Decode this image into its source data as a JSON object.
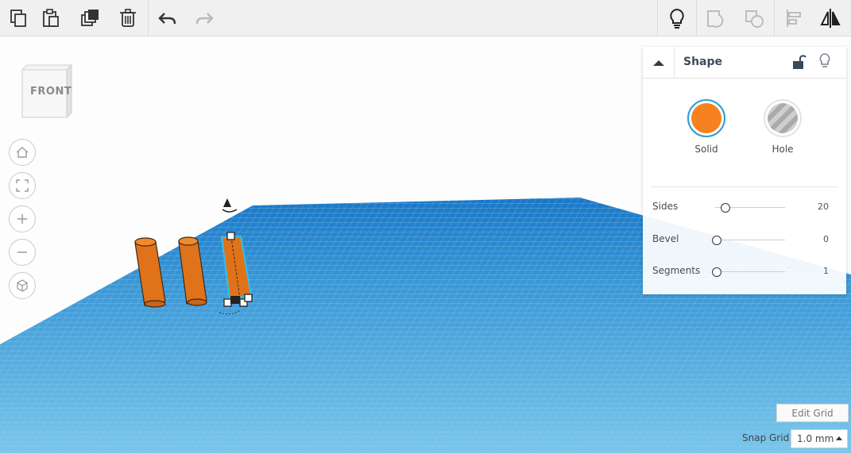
{
  "toolbar": {
    "left_tools": [
      {
        "name": "copy-icon"
      },
      {
        "name": "paste-icon"
      },
      {
        "name": "duplicate-icon"
      },
      {
        "name": "delete-icon"
      },
      {
        "name": "undo-icon"
      },
      {
        "name": "redo-icon"
      }
    ],
    "right_tools": [
      {
        "name": "lightbulb-icon"
      },
      {
        "name": "group-icon"
      },
      {
        "name": "ungroup-icon"
      },
      {
        "name": "align-icon"
      },
      {
        "name": "mirror-icon"
      }
    ]
  },
  "viewcube": {
    "face_label": "FRONT"
  },
  "nav": [
    {
      "name": "home-view-icon"
    },
    {
      "name": "fit-view-icon"
    },
    {
      "name": "zoom-in-icon"
    },
    {
      "name": "zoom-out-icon"
    },
    {
      "name": "perspective-icon"
    }
  ],
  "inspector": {
    "title": "Shape",
    "solid_label": "Solid",
    "hole_label": "Hole",
    "solid_color": "#f5811f",
    "properties": [
      {
        "label": "Sides",
        "value": "20",
        "fraction": 0.12
      },
      {
        "label": "Bevel",
        "value": "0",
        "fraction": 0.0
      },
      {
        "label": "Segments",
        "value": "1",
        "fraction": 0.0
      }
    ]
  },
  "workplane": {
    "color": "#3fa6de",
    "grid_color": "#9fd3f0"
  },
  "edit_grid_label": "Edit Grid",
  "snap_grid": {
    "label": "Snap Grid",
    "value": "1.0 mm"
  }
}
